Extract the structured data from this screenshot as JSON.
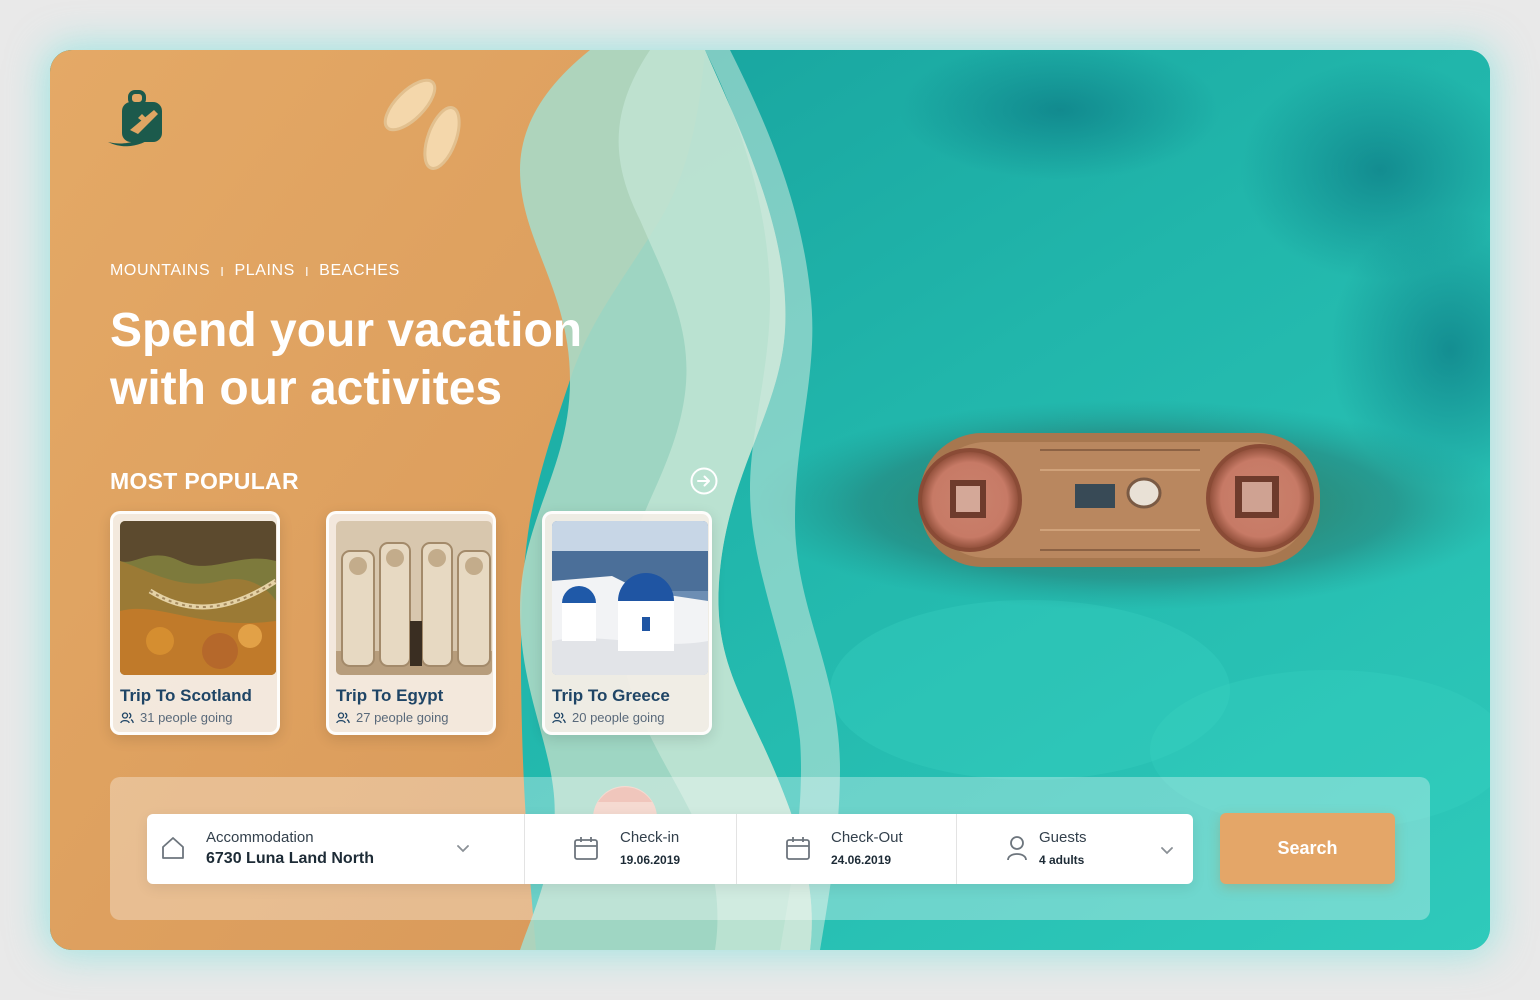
{
  "categories": [
    "MOUNTAINS",
    "PLAINS",
    "BEACHES"
  ],
  "category_separator": "I",
  "hero": {
    "title_line1": "Spend your vacation",
    "title_line2": "with our activites"
  },
  "popular": {
    "title": "MOST POPULAR",
    "cards": [
      {
        "title": "Trip To Scotland",
        "people": "31 people going"
      },
      {
        "title": "Trip To Egypt",
        "people": "27 people going"
      },
      {
        "title": "Trip To Greece",
        "people": "20 people going"
      }
    ]
  },
  "search": {
    "accommodation": {
      "label": "Accommodation",
      "value": "6730 Luna Land North"
    },
    "checkin": {
      "label": "Check-in",
      "value": "19.06.2019"
    },
    "checkout": {
      "label": "Check-Out",
      "value": "24.06.2019"
    },
    "guests": {
      "label": "Guests",
      "value": "4 adults"
    },
    "button_label": "Search"
  },
  "colors": {
    "sand": "#e0a563",
    "sea": "#1fb2a6",
    "foam": "#a8d7c3",
    "accent": "#e4a668",
    "title_blue": "#1f4566",
    "logo": "#1c5a4c"
  },
  "icons": [
    "suitcase-plane-logo",
    "arrow-right-circle-icon",
    "people-icon",
    "home-icon",
    "calendar-icon",
    "user-icon",
    "chevron-down-icon"
  ]
}
